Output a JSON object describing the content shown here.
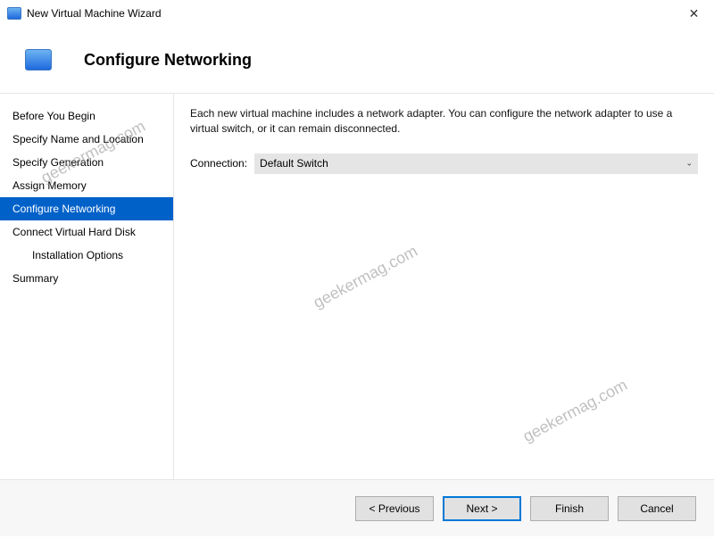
{
  "window": {
    "title": "New Virtual Machine Wizard"
  },
  "header": {
    "page_title": "Configure Networking"
  },
  "sidebar": {
    "items": [
      {
        "label": "Before You Begin",
        "indent": false,
        "active": false
      },
      {
        "label": "Specify Name and Location",
        "indent": false,
        "active": false
      },
      {
        "label": "Specify Generation",
        "indent": false,
        "active": false
      },
      {
        "label": "Assign Memory",
        "indent": false,
        "active": false
      },
      {
        "label": "Configure Networking",
        "indent": false,
        "active": true
      },
      {
        "label": "Connect Virtual Hard Disk",
        "indent": false,
        "active": false
      },
      {
        "label": "Installation Options",
        "indent": true,
        "active": false
      },
      {
        "label": "Summary",
        "indent": false,
        "active": false
      }
    ]
  },
  "content": {
    "instruction": "Each new virtual machine includes a network adapter. You can configure the network adapter to use a virtual switch, or it can remain disconnected.",
    "connection_label": "Connection:",
    "connection_value": "Default Switch"
  },
  "buttons": {
    "previous": "< Previous",
    "next": "Next >",
    "finish": "Finish",
    "cancel": "Cancel"
  },
  "watermark": "geekermag.com"
}
